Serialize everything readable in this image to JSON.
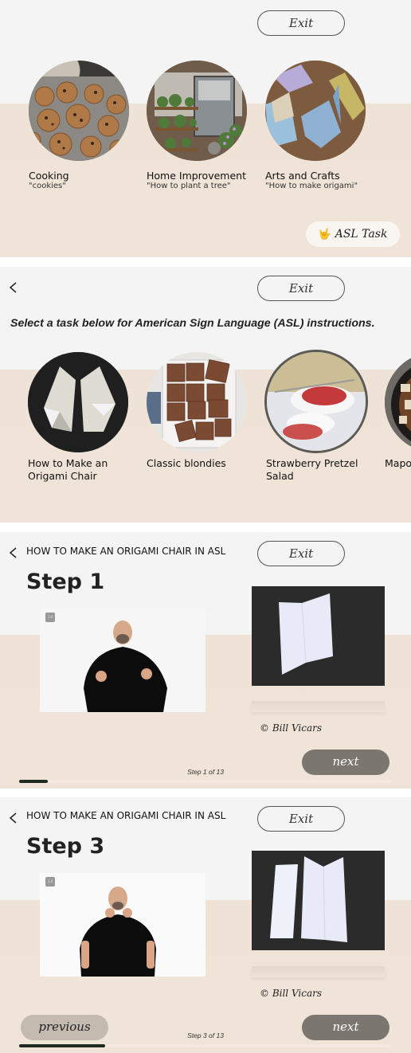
{
  "common": {
    "exit_label": "Exit"
  },
  "panel1": {
    "categories": [
      {
        "title": "Cooking",
        "subtitle": "\"cookies\"",
        "image": "cookies-photo"
      },
      {
        "title": "Home Improvement",
        "subtitle": "\"How to plant a tree\"",
        "image": "plant-shelf-photo"
      },
      {
        "title": "Arts and Crafts",
        "subtitle": "\"How to make origami\"",
        "image": "origami-cranes-photo"
      }
    ],
    "asl_button": {
      "icon": "🤟",
      "label": "ASL Task"
    }
  },
  "panel2": {
    "instruction": "Select a task below for American Sign Language (ASL) instructions.",
    "tasks": [
      {
        "title": "How to Make an Origami Chair",
        "image": "origami-chair-photo"
      },
      {
        "title": "Classic blondies",
        "image": "blondies-photo"
      },
      {
        "title": "Strawberry Pretzel Salad",
        "image": "strawberry-salad-photo"
      },
      {
        "title": "Mapo",
        "image": "mapo-dish-photo"
      }
    ]
  },
  "panel3": {
    "breadcrumb": "HOW TO MAKE AN ORIGAMI CHAIR IN ASL",
    "step_title": "Step 1",
    "video_badge": "1.0",
    "credit": "© Bill Vicars",
    "step_counter": "Step 1 of 13",
    "current_step": 1,
    "total_steps": 13,
    "next_label": "next"
  },
  "panel4": {
    "breadcrumb": "HOW TO MAKE AN ORIGAMI CHAIR IN ASL",
    "step_title": "Step 3",
    "video_badge": "1.0",
    "credit": "© Bill Vicars",
    "step_counter": "Step 3 of 13",
    "current_step": 3,
    "total_steps": 13,
    "previous_label": "previous",
    "next_label": "next"
  }
}
